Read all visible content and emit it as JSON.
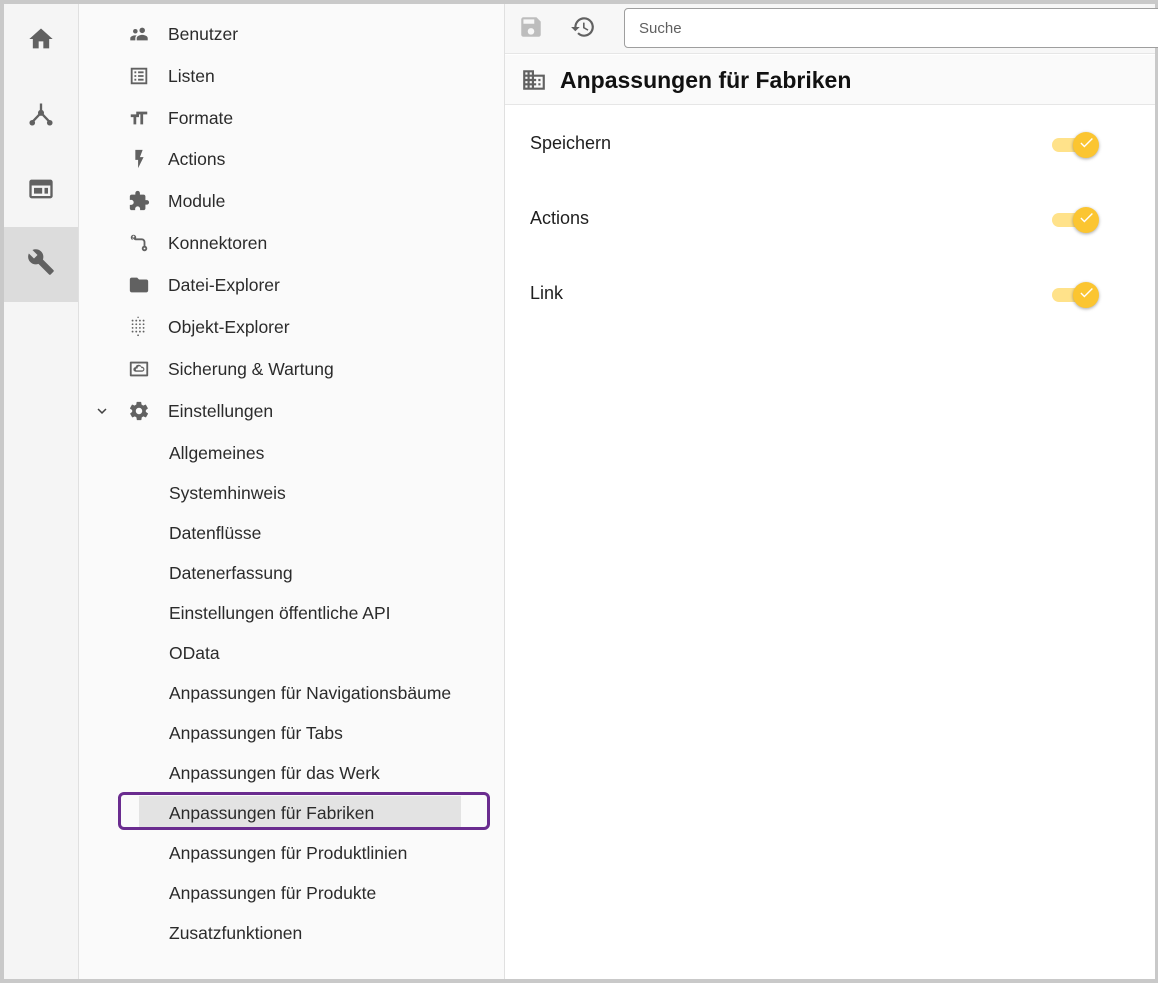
{
  "rail": {
    "items": [
      {
        "name": "home-icon",
        "active": false
      },
      {
        "name": "share-nodes-icon",
        "active": false
      },
      {
        "name": "browser-window-icon",
        "active": false
      },
      {
        "name": "wrench-icon",
        "active": true
      }
    ]
  },
  "nav": {
    "items": [
      {
        "label": "Benutzer",
        "icon": "people-icon"
      },
      {
        "label": "Listen",
        "icon": "list-icon"
      },
      {
        "label": "Formate",
        "icon": "text-format-icon"
      },
      {
        "label": "Actions",
        "icon": "bolt-icon"
      },
      {
        "label": "Module",
        "icon": "puzzle-icon"
      },
      {
        "label": "Konnektoren",
        "icon": "route-icon"
      },
      {
        "label": "Datei-Explorer",
        "icon": "folder-icon"
      },
      {
        "label": "Objekt-Explorer",
        "icon": "dot-grid-icon"
      },
      {
        "label": "Sicherung & Wartung",
        "icon": "cloud-backup-icon"
      },
      {
        "label": "Einstellungen",
        "icon": "gear-icon",
        "expanded": true
      }
    ],
    "sub_items": [
      {
        "label": "Allgemeines"
      },
      {
        "label": "Systemhinweis"
      },
      {
        "label": "Datenflüsse"
      },
      {
        "label": "Datenerfassung"
      },
      {
        "label": "Einstellungen öffentliche API"
      },
      {
        "label": "OData"
      },
      {
        "label": "Anpassungen für Navigationsbäume"
      },
      {
        "label": "Anpassungen für Tabs"
      },
      {
        "label": "Anpassungen für das Werk"
      },
      {
        "label": "Anpassungen für Fabriken",
        "selected": true
      },
      {
        "label": "Anpassungen für Produktlinien"
      },
      {
        "label": "Anpassungen für Produkte"
      },
      {
        "label": "Zusatzfunktionen"
      }
    ],
    "selected_outline_color": "#6a2c8f"
  },
  "toolbar": {
    "save_icon": "save-icon",
    "history_icon": "history-icon",
    "search_placeholder": "Suche"
  },
  "page": {
    "icon": "factory-icon",
    "title": "Anpassungen für Fabriken",
    "settings": [
      {
        "label": "Speichern",
        "enabled": true
      },
      {
        "label": "Actions",
        "enabled": true
      },
      {
        "label": "Link",
        "enabled": true
      }
    ]
  },
  "colors": {
    "toggle_on": "#fbc531",
    "toggle_track": "#ffe28a"
  }
}
